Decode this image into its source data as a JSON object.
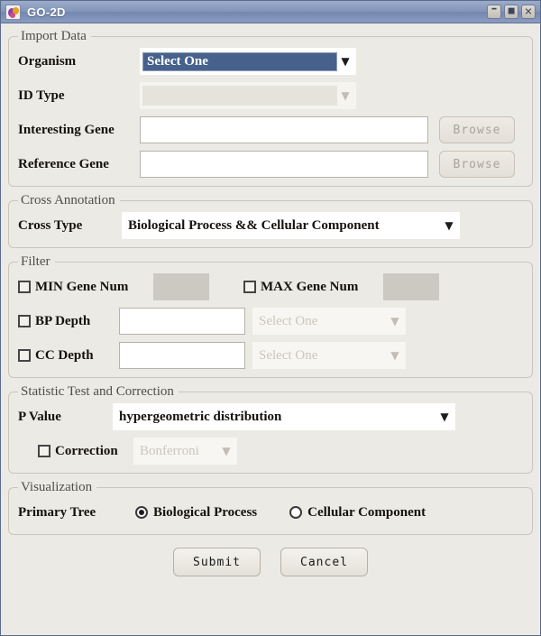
{
  "window": {
    "title": "GO-2D",
    "icon": "app-icon",
    "controls": [
      {
        "name": "minimize",
        "glyph": "–"
      },
      {
        "name": "maximize",
        "glyph": "⬛"
      },
      {
        "name": "close",
        "glyph": "✕"
      }
    ]
  },
  "import_data": {
    "legend": "Import Data",
    "organism_label": "Organism",
    "organism_value": "Select One",
    "id_type_label": "ID Type",
    "id_type_value": "",
    "interesting_gene_label": "Interesting Gene",
    "interesting_gene_value": "",
    "reference_gene_label": "Reference Gene",
    "reference_gene_value": "",
    "browse_label": "Browse"
  },
  "cross_annotation": {
    "legend": "Cross Annotation",
    "cross_type_label": "Cross Type",
    "cross_type_value": "Biological Process && Cellular Component"
  },
  "filter": {
    "legend": "Filter",
    "min_gene_num_label": "MIN Gene Num",
    "min_gene_num_value": "",
    "max_gene_num_label": "MAX Gene Num",
    "max_gene_num_value": "",
    "bp_depth_label": "BP Depth",
    "bp_depth_value": "",
    "bp_depth_select": "Select One",
    "cc_depth_label": "CC Depth",
    "cc_depth_value": "",
    "cc_depth_select": "Select One"
  },
  "statistic": {
    "legend": "Statistic Test and Correction",
    "p_value_label": "P Value",
    "p_value_value": "hypergeometric distribution",
    "correction_label": "Correction",
    "correction_value": "Bonferroni"
  },
  "visualization": {
    "legend": "Visualization",
    "primary_tree_label": "Primary Tree",
    "option_bp": "Biological Process",
    "option_cc": "Cellular Component"
  },
  "actions": {
    "submit_label": "Submit",
    "cancel_label": "Cancel"
  },
  "colors": {
    "titlebar": "#8296ba",
    "selection": "#46618c",
    "panel": "#eceae4",
    "field": "#ffffff",
    "disabled_field": "#ccc9c2"
  }
}
